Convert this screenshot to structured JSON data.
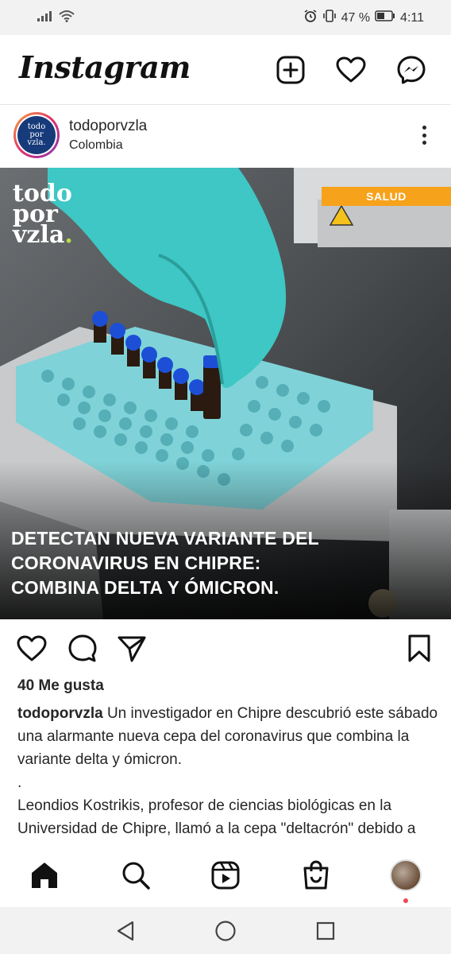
{
  "status_bar": {
    "battery": "47 %",
    "time": "4:11"
  },
  "header": {
    "logo": "Instagram",
    "icons": [
      "plus-square-icon",
      "heart-icon",
      "messenger-icon"
    ]
  },
  "post": {
    "avatar_text": [
      "todo",
      "por",
      "vzla."
    ],
    "username": "todoporvzla",
    "location": "Colombia",
    "image": {
      "brand_lines": [
        "todo",
        "por",
        "vzla"
      ],
      "brand_dot": ".",
      "tag": "SALUD",
      "headline_lines": [
        "DETECTAN NUEVA VARIANTE DEL",
        "CORONAVIRUS EN CHIPRE:",
        "COMBINA DELTA Y ÓMICRON."
      ]
    },
    "likes": "40 Me gusta",
    "caption": {
      "user": "todoporvzla",
      "text": " Un investigador en Chipre descubrió este sábado una alarmante nueva cepa del coronavirus que combina la variante delta y ómicron.",
      "separator": ".",
      "paragraph2": "Leondios Kostrikis, profesor de ciencias biológicas en la Universidad de Chipre, llamó a la cepa \"deltacrón\" debido a que sus firmas genéticas similares"
    }
  },
  "bottom_nav": {
    "items": [
      "home-icon",
      "search-icon",
      "reels-icon",
      "shop-icon",
      "profile-avatar"
    ]
  },
  "colors": {
    "accent_tag": "#f7a21b",
    "brand_dot": "#b6e04a",
    "glove": "#3ec7c4",
    "tray": "#7fd3d8",
    "vial_cap": "#1d4fd6"
  }
}
